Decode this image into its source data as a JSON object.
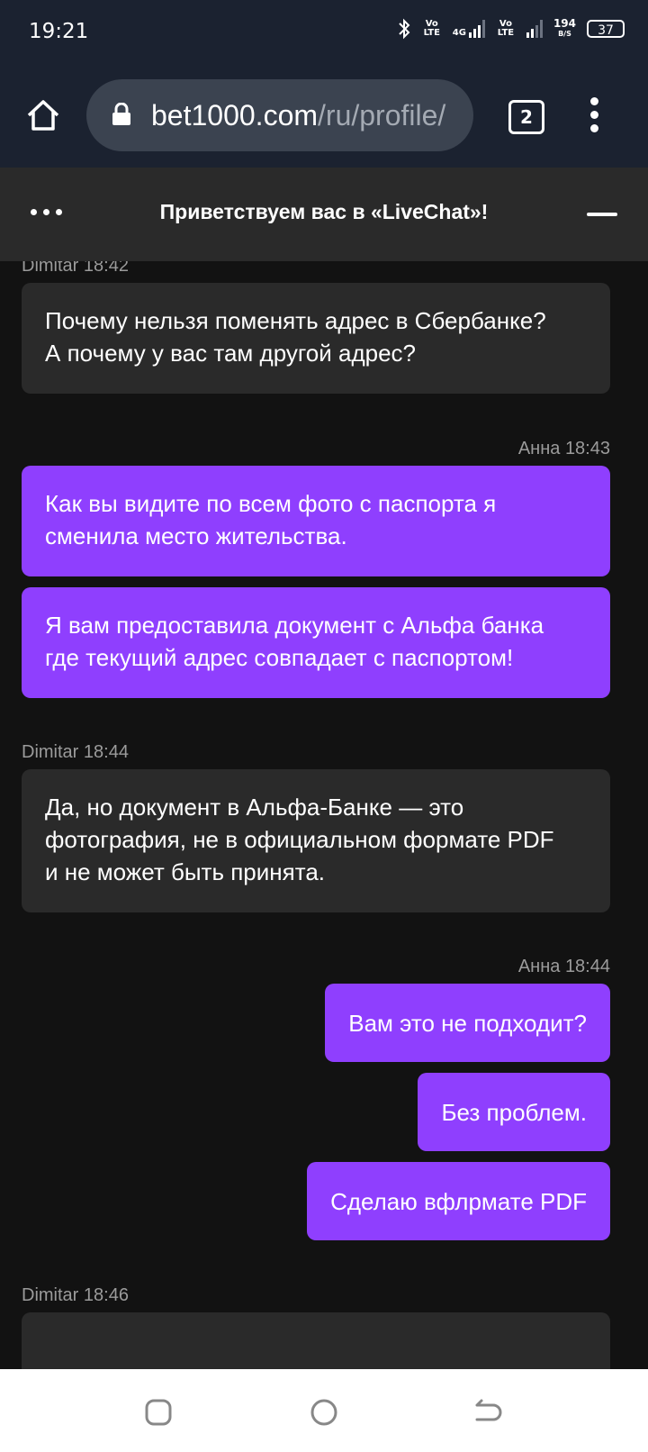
{
  "status_bar": {
    "time": "19:21",
    "net1": "Vo LTE",
    "net_type": "4G",
    "net2": "Vo LTE",
    "speed_value": "194",
    "speed_unit": "B/S",
    "battery": "37"
  },
  "browser": {
    "url_host": "bet1000.com",
    "url_path": "/ru/profile/",
    "tab_count": "2"
  },
  "chat": {
    "title": "Приветствуем вас в «LiveChat»!",
    "groups": [
      {
        "meta": "Dimitar 18:42",
        "messages": [
          "Почему нельзя поменять адрес в Сбербанке?",
          "А почему у вас там другой адрес?"
        ]
      },
      {
        "meta": "Анна 18:43",
        "messages": [
          "Как вы видите по всем фото с паспорта я",
          "сменила место жительства.",
          "Я вам предоставила документ с Альфа банка",
          "где текущий адрес совпадает с паспортом!"
        ]
      },
      {
        "meta": "Dimitar 18:44",
        "messages": [
          "Да, но документ в Альфа-Банке — это",
          "фотография, не в официальном формате PDF",
          "и не может быть принята."
        ]
      },
      {
        "meta": "Анна 18:44",
        "messages": [
          "Вам это не подходит?",
          "Без проблем.",
          "Сделаю вфлрмате PDF"
        ]
      },
      {
        "meta": "Dimitar 18:46",
        "messages": []
      }
    ]
  },
  "colors": {
    "agent_bubble": "#2a2a2a",
    "user_bubble": "#8f3ffe",
    "background": "#121212"
  }
}
